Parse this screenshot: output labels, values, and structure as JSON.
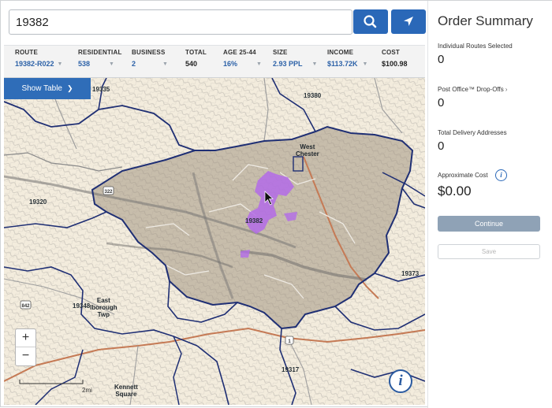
{
  "search": {
    "value": "19382"
  },
  "stats": [
    {
      "label": "ROUTE",
      "value": "19382-R022",
      "has_dropdown": true
    },
    {
      "label": "RESIDENTIAL",
      "value": "538",
      "has_dropdown": true
    },
    {
      "label": "BUSINESS",
      "value": "2",
      "has_dropdown": true
    },
    {
      "label": "TOTAL",
      "value": "540",
      "has_dropdown": false
    },
    {
      "label": "AGE 25-44",
      "value": "16%",
      "has_dropdown": true
    },
    {
      "label": "SIZE",
      "value": "2.93 PPL",
      "has_dropdown": true
    },
    {
      "label": "INCOME",
      "value": "$113.72K",
      "has_dropdown": true
    },
    {
      "label": "COST",
      "value": "$100.98",
      "has_dropdown": false
    }
  ],
  "map": {
    "show_table": "Show Table",
    "zoom_in": "+",
    "zoom_out": "−",
    "scale": "2mi",
    "info": "i",
    "labels": {
      "r19335": "19335",
      "r19380": "19380",
      "r19320": "19320",
      "r19382": "19382",
      "r19373": "19373",
      "r19348": "19348",
      "r19317": "19317",
      "place_west_chester_1": "West",
      "place_west_chester_2": "Chester",
      "place_east_1": "East",
      "place_east_2": "lborough",
      "place_east_3": "Twp",
      "place_kennett_1": "Kennett",
      "place_kennett_2": "Square",
      "shield_322": "322",
      "shield_842": "842",
      "shield_1": "1"
    }
  },
  "sidebar": {
    "title": "Order Summary",
    "routes_label": "Individual Routes Selected",
    "routes_value": "0",
    "po_label": "Post Office™ Drop-Offs",
    "po_chevron": "›",
    "po_value": "0",
    "delivery_label": "Total Delivery Addresses",
    "delivery_value": "0",
    "cost_label": "Approximate Cost",
    "cost_info": "i",
    "cost_value": "$0.00",
    "continue": "Continue",
    "save": "Save"
  },
  "colors": {
    "primary_blue": "#2a68b8",
    "boundary_navy": "#1f2f74",
    "selection_purple": "#b36be8",
    "map_paper": "#f3ecdd"
  }
}
